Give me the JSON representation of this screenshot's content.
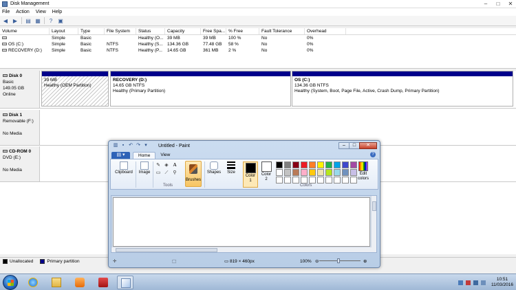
{
  "dm": {
    "title": "Disk Management",
    "menu": [
      "File",
      "Action",
      "View",
      "Help"
    ],
    "columns": [
      "Volume",
      "Layout",
      "Type",
      "File System",
      "Status",
      "Capacity",
      "Free Spa...",
      "% Free",
      "Fault Tolerance",
      "Overhead"
    ],
    "volumes": [
      [
        "",
        "Simple",
        "Basic",
        "",
        "Healthy (O...",
        "39 MB",
        "39 MB",
        "100 %",
        "No",
        "0%"
      ],
      [
        "OS (C:)",
        "Simple",
        "Basic",
        "NTFS",
        "Healthy (S...",
        "134.36 GB",
        "77.48 GB",
        "58 %",
        "No",
        "0%"
      ],
      [
        "RECOVERY (D:)",
        "Simple",
        "Basic",
        "NTFS",
        "Healthy (P...",
        "14.65 GB",
        "361 MB",
        "2 %",
        "No",
        "0%"
      ]
    ],
    "disks": [
      {
        "name": "Disk 0",
        "type": "Basic",
        "size": "149.05 GB",
        "status": "Online",
        "partitions": [
          {
            "title": "",
            "size": "39 MB",
            "status": "Healthy (OEM Partition)"
          },
          {
            "title": "RECOVERY  (D:)",
            "size": "14.65 GB NTFS",
            "status": "Healthy (Primary Partition)"
          },
          {
            "title": "OS  (C:)",
            "size": "134.36 GB NTFS",
            "status": "Healthy (System, Boot, Page File, Active, Crash Dump, Primary Partition)"
          }
        ]
      },
      {
        "name": "Disk 1",
        "type": "Removable (F:)",
        "status": "No Media"
      },
      {
        "name": "CD-ROM 0",
        "type": "DVD (E:)",
        "status": "No Media"
      }
    ],
    "legend": {
      "unallocated": "Unallocated",
      "primary": "Primary partition"
    },
    "colors": {
      "unallocated": "#000000",
      "primary": "#00008b"
    }
  },
  "paint": {
    "title": "Untitled - Paint",
    "tabs": [
      "Home",
      "View"
    ],
    "clipboard": "Clipboard",
    "image": "Image",
    "tools": "Tools",
    "brushes": "Brushes",
    "shapes": "Shapes",
    "size": "Size",
    "color1": "Color\n1",
    "color2": "Color\n2",
    "colors_group": "Colors",
    "edit_colors": "Edit\ncolors",
    "dimensions": "819 × 460px",
    "zoom": "100%",
    "palette": [
      "#000000",
      "#7f7f7f",
      "#880015",
      "#ed1c24",
      "#ff7f27",
      "#fff200",
      "#22b14c",
      "#00a2e8",
      "#3f48cc",
      "#a349a4",
      "#ffffff",
      "#c3c3c3",
      "#b97a57",
      "#ffaec9",
      "#ffc90e",
      "#efe4b0",
      "#b5e61d",
      "#99d9ea",
      "#7092be",
      "#c8bfe7",
      "#ffffff",
      "#ffffff",
      "#ffffff",
      "#ffffff",
      "#ffffff",
      "#ffffff",
      "#ffffff",
      "#ffffff",
      "#ffffff",
      "#ffffff"
    ]
  },
  "taskbar": {
    "time": "10:51",
    "date": "11/03/2016"
  }
}
